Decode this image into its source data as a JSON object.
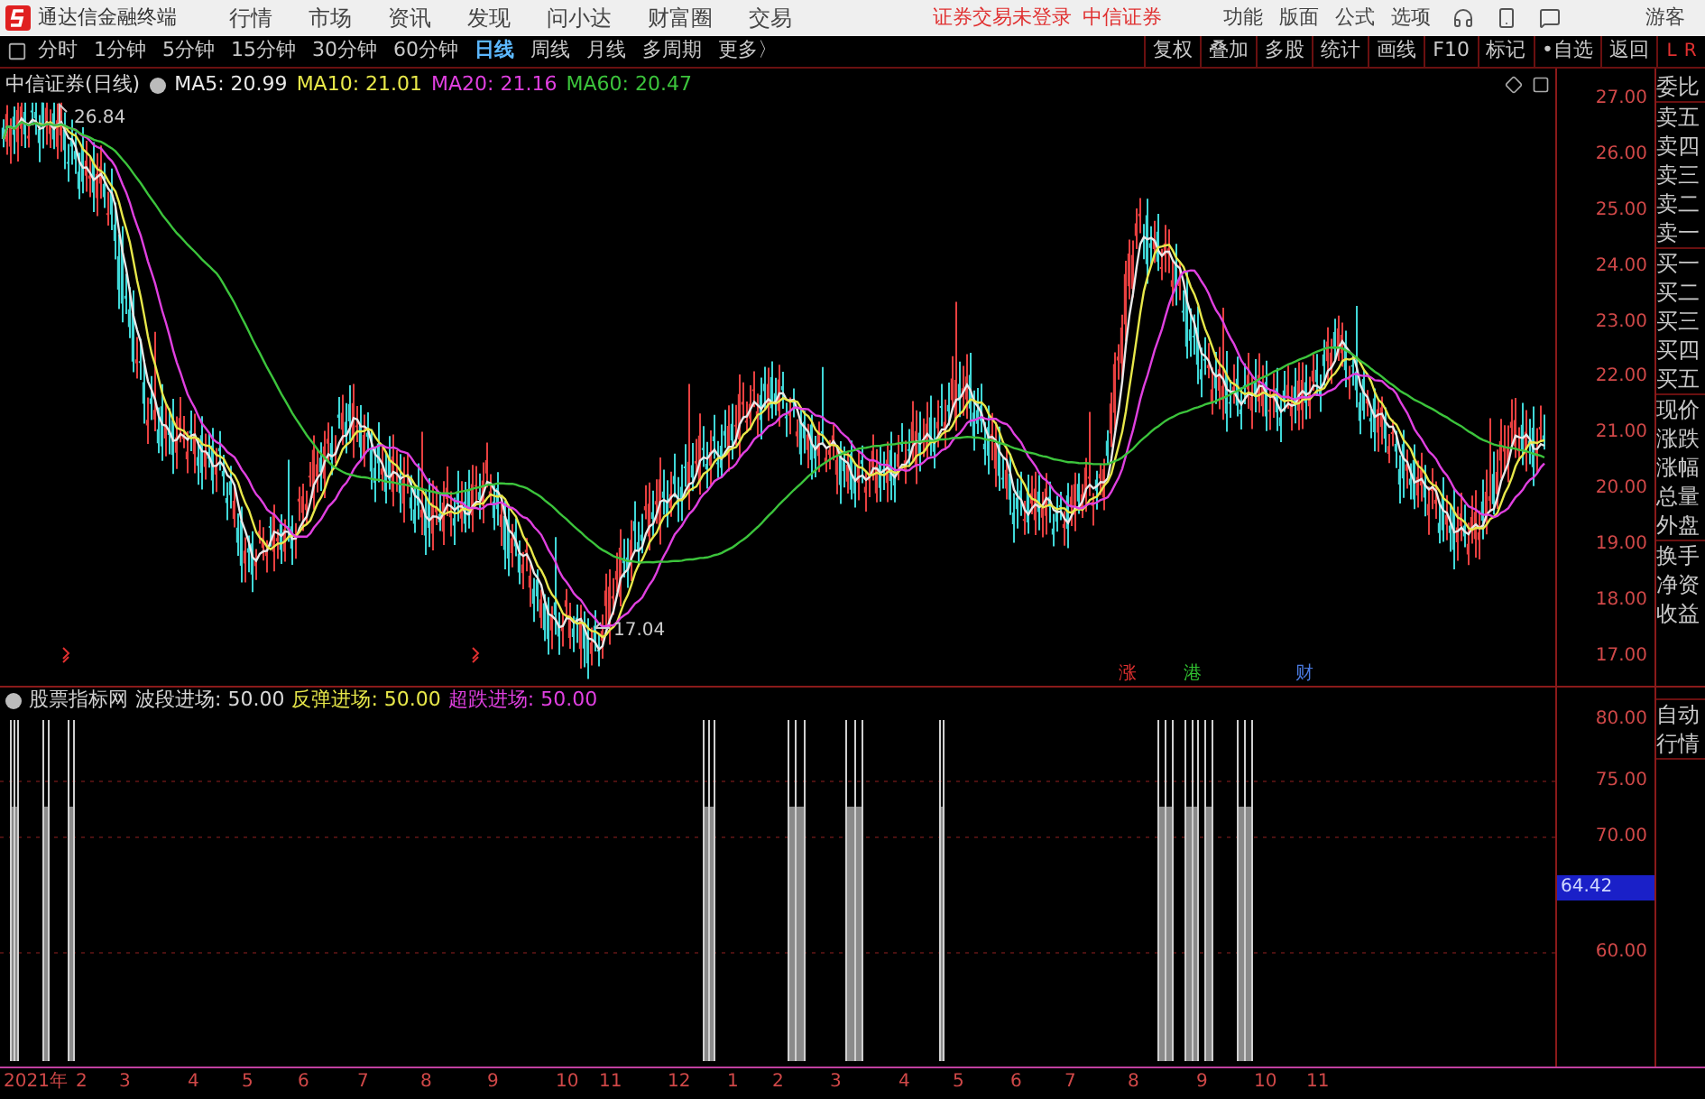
{
  "title_bar": {
    "app_name": "通达信金融终端",
    "menu": [
      "行情",
      "市场",
      "资讯",
      "发现",
      "问小达",
      "财富圈",
      "交易"
    ],
    "status": [
      "证券交易未登录",
      "中信证券"
    ],
    "tools": [
      "功能",
      "版面",
      "公式",
      "选项"
    ],
    "user": "游客"
  },
  "toolbar": {
    "periods": [
      {
        "label": "分时",
        "selected": false
      },
      {
        "label": "1分钟",
        "selected": false
      },
      {
        "label": "5分钟",
        "selected": false
      },
      {
        "label": "15分钟",
        "selected": false
      },
      {
        "label": "30分钟",
        "selected": false
      },
      {
        "label": "60分钟",
        "selected": false
      },
      {
        "label": "日线",
        "selected": true
      },
      {
        "label": "周线",
        "selected": false
      },
      {
        "label": "月线",
        "selected": false
      },
      {
        "label": "多周期",
        "selected": false
      },
      {
        "label": "更多〉",
        "selected": false
      }
    ],
    "actions": [
      "复权",
      "叠加",
      "多股",
      "统计",
      "画线",
      "F10",
      "标记",
      "•自选",
      "返回"
    ],
    "corner": [
      "L",
      "R"
    ]
  },
  "main_chart": {
    "title": "中信证券(日线)",
    "ma": [
      {
        "label": "MA5: 20.99",
        "color": "#e8e8e8"
      },
      {
        "label": "MA10: 21.01",
        "color": "#e8e84a"
      },
      {
        "label": "MA20: 21.16",
        "color": "#e040e0"
      },
      {
        "label": "MA60: 20.47",
        "color": "#3cc43c"
      }
    ],
    "high_label": "26.84",
    "low_label": "17.04",
    "events": [
      {
        "label": "涨",
        "color": "#e03030"
      },
      {
        "label": "港",
        "color": "#30c030"
      },
      {
        "label": "财",
        "color": "#4a7ae0"
      }
    ],
    "price_axis": [
      "27.00",
      "26.00",
      "25.00",
      "24.00",
      "23.00",
      "22.00",
      "21.00",
      "20.00",
      "19.00",
      "18.00",
      "17.00"
    ]
  },
  "side_panel": {
    "groups": [
      [
        "委比"
      ],
      [
        "卖五",
        "卖四",
        "卖三",
        "卖二",
        "卖一"
      ],
      [
        "买一",
        "买二",
        "买三",
        "买四",
        "买五"
      ],
      [
        "现价",
        "涨跌",
        "涨幅",
        "总量",
        "外盘"
      ],
      [
        "换手",
        "净资",
        "收益"
      ]
    ]
  },
  "indicator": {
    "name": "股票指标网",
    "lines": [
      {
        "label": "波段进场: 50.00",
        "color": "#d8d8d8"
      },
      {
        "label": "反弹进场: 50.00",
        "color": "#e8e84a"
      },
      {
        "label": "超跌进场: 50.00",
        "color": "#e040e0"
      }
    ],
    "axis": [
      {
        "label": "80.00",
        "kind": "tick"
      },
      {
        "label": "75.00",
        "kind": "tick"
      },
      {
        "label": "70.00",
        "kind": "tick"
      },
      {
        "label": "64.42",
        "kind": "current"
      },
      {
        "label": "60.00",
        "kind": "tick"
      }
    ],
    "side": [
      "自动",
      "行情"
    ]
  },
  "x_axis": [
    "2021年",
    "2",
    "3",
    "4",
    "5",
    "6",
    "7",
    "8",
    "9",
    "10",
    "11",
    "12",
    "1",
    "2",
    "3",
    "4",
    "5",
    "6",
    "7",
    "8",
    "9",
    "10",
    "11"
  ]
}
